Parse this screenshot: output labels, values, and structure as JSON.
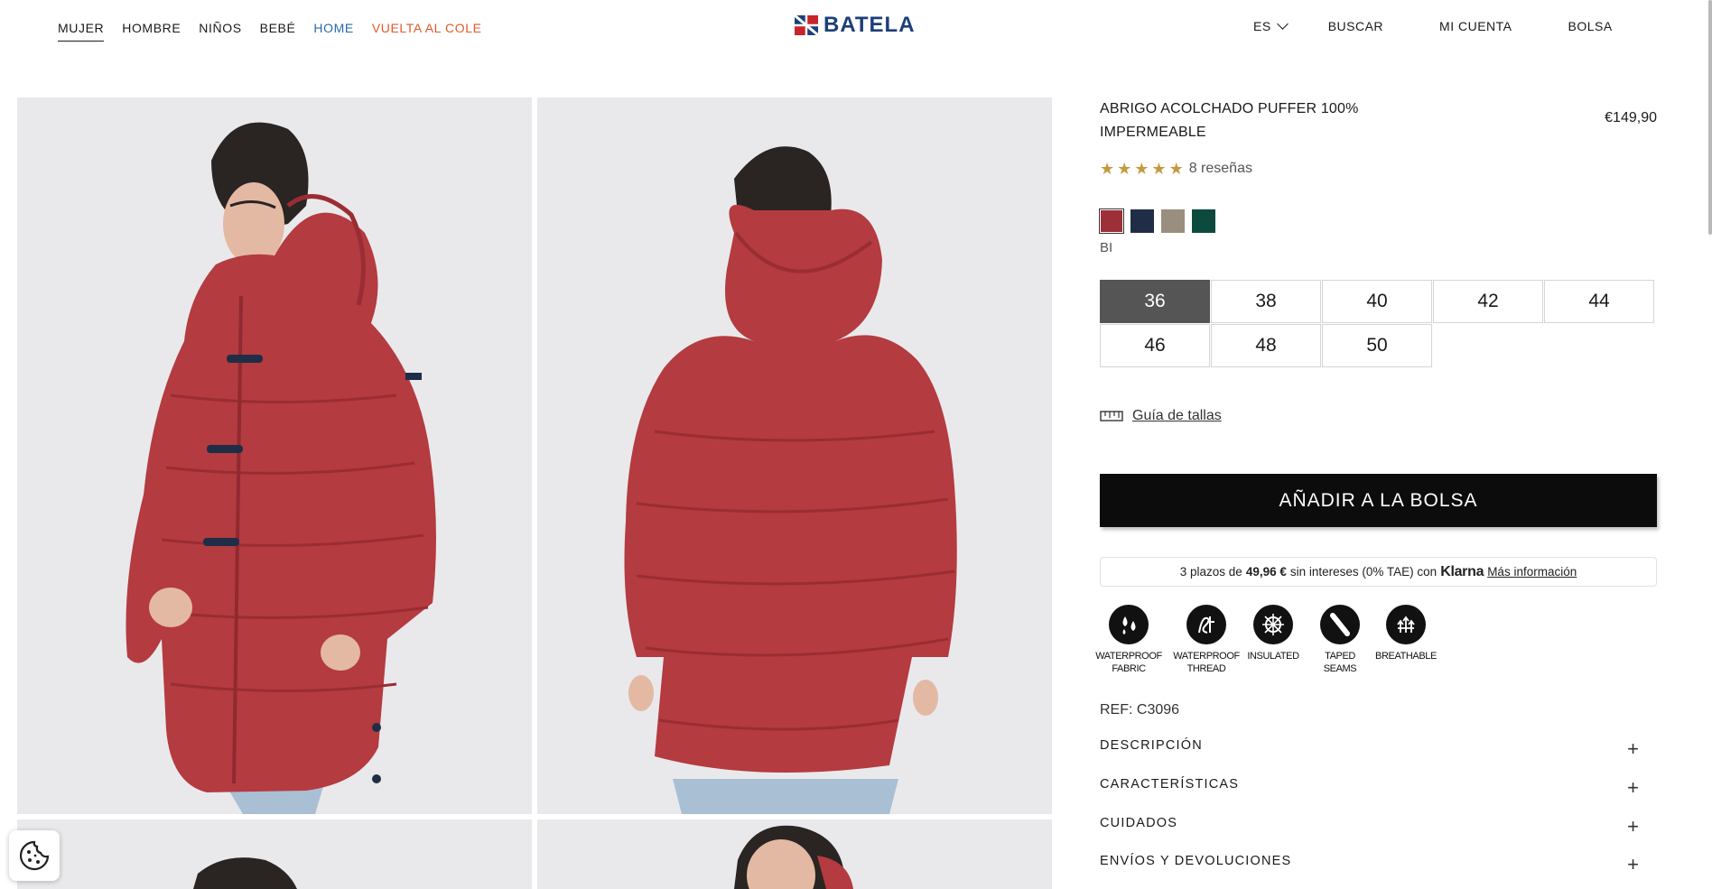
{
  "nav": {
    "left": [
      "MUJER",
      "HOMBRE",
      "NIÑOS",
      "BEBÉ",
      "HOME",
      "VUELTA AL COLE"
    ],
    "active": "MUJER",
    "brand": "BATELA",
    "language": "ES",
    "search": "BUSCAR",
    "account": "MI CUENTA",
    "bag": "BOLSA"
  },
  "colors": {
    "brand_blue": "#1c3f7a",
    "brand_red": "#c8242b",
    "home_link": "#2a6aa8",
    "cole_link": "#e05a28",
    "jacket_red": "#b43b40",
    "star": "#c59a3f"
  },
  "gallery": {
    "images": [
      {
        "alt": "front-view"
      },
      {
        "alt": "back-view"
      },
      {
        "alt": "side-view"
      },
      {
        "alt": "detail-view"
      }
    ]
  },
  "product": {
    "title": "ABRIGO ACOLCHADO PUFFER 100% IMPERMEABLE",
    "price": "€149,90",
    "rating": 5,
    "reviews": "8 reseñas",
    "swatches": [
      {
        "color": "#9c2f38",
        "selected": true
      },
      {
        "color": "#1f2e46",
        "selected": false
      },
      {
        "color": "#9a8e7e",
        "selected": false
      },
      {
        "color": "#0d4a3e",
        "selected": false
      }
    ],
    "color_name": "BI",
    "sizes": [
      "36",
      "38",
      "40",
      "42",
      "44",
      "46",
      "48",
      "50"
    ],
    "selected_size": "36",
    "size_guide": "Guía de tallas",
    "add_to_bag": "AÑADIR A LA BOLSA",
    "klarna": {
      "prefix": "3 plazos de",
      "amount": "49,96 €",
      "middle": "sin intereses (0% TAE) con",
      "logo": "Klarna",
      "link": "Más información"
    },
    "features": [
      {
        "icon": "waterproof-fabric-icon",
        "line1": "WATERPROOF",
        "line2": "FABRIC"
      },
      {
        "icon": "waterproof-thread-icon",
        "line1": "WATERPROOF",
        "line2": "THREAD"
      },
      {
        "icon": "insulated-icon",
        "line1": "INSULATED",
        "line2": ""
      },
      {
        "icon": "taped-seams-icon",
        "line1": "TAPED SEAMS",
        "line2": ""
      },
      {
        "icon": "breathable-icon",
        "line1": "BREATHABLE",
        "line2": ""
      }
    ],
    "ref": "REF: C3096",
    "accordions": [
      "DESCRIPCIÓN",
      "CARACTERÍSTICAS",
      "CUIDADOS",
      "ENVÍOS Y DEVOLUCIONES"
    ],
    "accordion_icon": "+"
  }
}
